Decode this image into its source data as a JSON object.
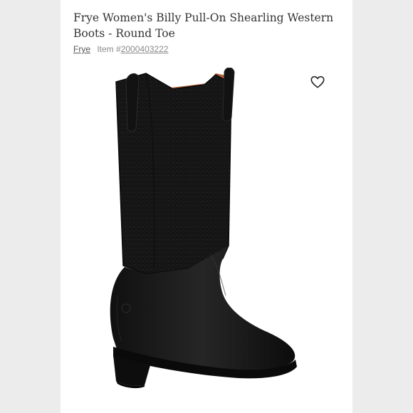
{
  "product": {
    "title": "Frye Women's Billy Pull-On Shearling Western Boots - Round Toe",
    "brand": "Frye",
    "item_label": "Item #",
    "item_number": "2000403222"
  },
  "icons": {
    "wishlist": "heart-outline-icon"
  },
  "colors": {
    "page_background": "#ececec",
    "card_background": "#ffffff",
    "title_text": "#333333",
    "meta_text": "#8a8a8a",
    "boot_leather": "#141414",
    "boot_lining": "#b5653a"
  }
}
